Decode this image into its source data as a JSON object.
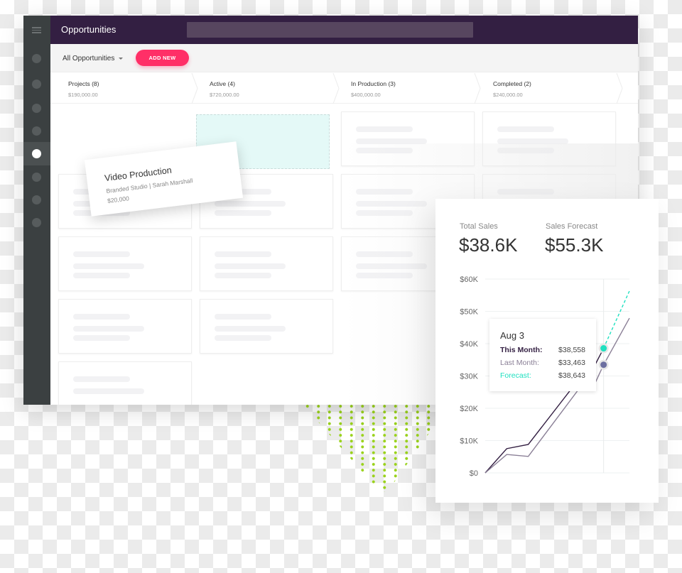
{
  "app": {
    "title": "Opportunities",
    "filter_label": "All Opportunities",
    "add_button": "ADD NEW",
    "stages": [
      {
        "name": "Projects (8)",
        "amount": "$190,000.00"
      },
      {
        "name": "Active (4)",
        "amount": "$720,000.00"
      },
      {
        "name": "In Production (3)",
        "amount": "$400,000.00"
      },
      {
        "name": "Completed (2)",
        "amount": "$240,000.00"
      }
    ],
    "dragged_card": {
      "title": "Video Production",
      "subtitle": "Branded Studio | Sarah Marshall",
      "amount": "$20,000"
    }
  },
  "sales": {
    "total_label": "Total Sales",
    "total_value": "$38.6K",
    "forecast_label": "Sales Forecast",
    "forecast_value": "$55.3K",
    "tooltip": {
      "date": "Aug 3",
      "rows": [
        {
          "label": "This Month:",
          "value": "$38,558",
          "color": "#331f42"
        },
        {
          "label": "Last Month:",
          "value": "$33,463",
          "color": "#8a7f96"
        },
        {
          "label": "Forecast:",
          "value": "$38,643",
          "color": "#1fe0c0"
        }
      ]
    }
  },
  "chart_data": {
    "type": "line",
    "title": "",
    "xlabel": "",
    "ylabel": "",
    "ylim": [
      0,
      60000
    ],
    "yticks": [
      "$0",
      "$10K",
      "$20K",
      "$30K",
      "$40K",
      "$50K",
      "$60K"
    ],
    "grid": true,
    "highlight_index": 5,
    "series": [
      {
        "name": "This Month",
        "color": "#331f42",
        "dashed": false,
        "x": [
          0,
          1,
          2,
          4.2,
          5.1,
          5.5
        ],
        "values": [
          0,
          7500,
          8800,
          27700,
          33400,
          38558
        ]
      },
      {
        "name": "Last Month",
        "color": "#8a7f96",
        "dashed": false,
        "x": [
          0,
          1,
          2,
          4.3,
          5.1,
          5.5,
          6.7
        ],
        "values": [
          0,
          5700,
          5100,
          25500,
          27700,
          33463,
          47900
        ]
      },
      {
        "name": "Forecast",
        "color": "#1fe0c0",
        "dashed": true,
        "x": [
          5.5,
          6.7
        ],
        "values": [
          38643,
          56300
        ]
      }
    ]
  }
}
